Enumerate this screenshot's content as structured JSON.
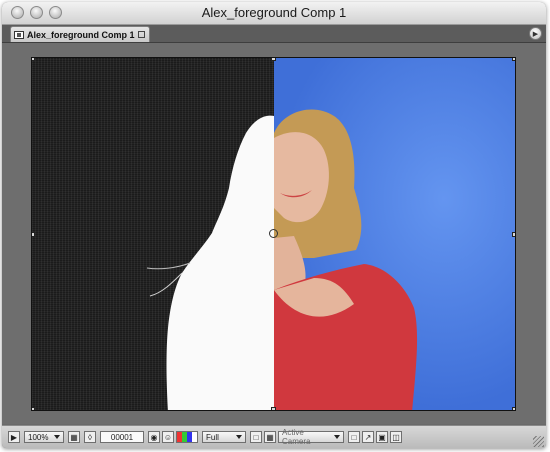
{
  "window": {
    "title": "Alex_foreground Comp 1"
  },
  "tab": {
    "label": "Alex_foreground Comp 1"
  },
  "icons": {
    "close": "window-close-icon",
    "minimize": "window-minimize-icon",
    "zoom": "window-zoom-icon",
    "comp": "composition-icon",
    "panel_menu": "panel-menu-icon"
  },
  "viewer": {
    "left_background": "#1b1b1b",
    "right_background": "#4a7be0"
  },
  "bottom_bar": {
    "magnification": "100%",
    "timecode": "00001",
    "resolution": "Full",
    "camera": "Active Camera"
  }
}
